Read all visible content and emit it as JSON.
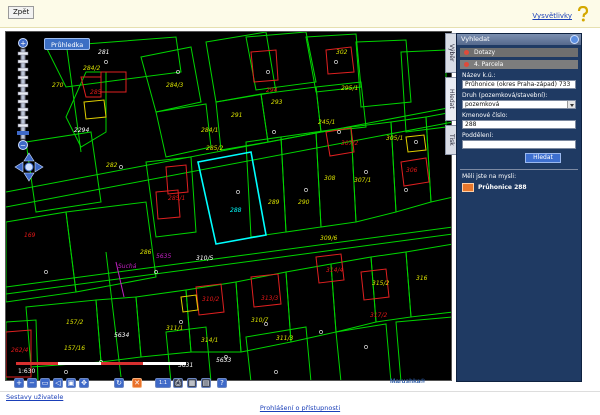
{
  "topbar": {
    "back_label": "Zpět",
    "help_label": "Vysvětlivky",
    "help_icon": "question-mark-icon"
  },
  "map": {
    "layer_button": "Průhledka",
    "scale_ratio": "1:630",
    "colors": {
      "background": "#000000",
      "parcel_lines": "#00e000",
      "selected_parcel": "#00ffff",
      "label_green": "#d8e000",
      "label_red": "#e01818",
      "label_magenta": "#c020c0"
    },
    "selected_parcel_number": "288",
    "parcel_labels": [
      {
        "text": "281",
        "style": "white"
      },
      {
        "text": "284/2",
        "style": "green"
      },
      {
        "text": "285",
        "style": "red"
      },
      {
        "text": "284/3",
        "style": "green"
      },
      {
        "text": "284/1",
        "style": "green"
      },
      {
        "text": "291",
        "style": "green"
      },
      {
        "text": "294",
        "style": "red"
      },
      {
        "text": "293",
        "style": "green"
      },
      {
        "text": "295/1",
        "style": "green"
      },
      {
        "text": "302",
        "style": "green"
      },
      {
        "text": "285/2",
        "style": "green"
      },
      {
        "text": "245/1",
        "style": "green"
      },
      {
        "text": "307/2",
        "style": "red"
      },
      {
        "text": "305/1",
        "style": "green"
      },
      {
        "text": "282",
        "style": "green"
      },
      {
        "text": "285/1",
        "style": "red"
      },
      {
        "text": "289",
        "style": "green"
      },
      {
        "text": "290",
        "style": "green"
      },
      {
        "text": "308",
        "style": "green"
      },
      {
        "text": "307/1",
        "style": "green"
      },
      {
        "text": "306",
        "style": "red"
      },
      {
        "text": "2294",
        "style": "white"
      },
      {
        "text": "270",
        "style": "green"
      },
      {
        "text": "169",
        "style": "red"
      },
      {
        "text": "286",
        "style": "green"
      },
      {
        "text": "309/6",
        "style": "green"
      },
      {
        "text": "310/5",
        "style": "white"
      },
      {
        "text": "310/2",
        "style": "red"
      },
      {
        "text": "313/3",
        "style": "red"
      },
      {
        "text": "314/4",
        "style": "red"
      },
      {
        "text": "315/2",
        "style": "green"
      },
      {
        "text": "316",
        "style": "green"
      },
      {
        "text": "317/2",
        "style": "red"
      },
      {
        "text": "310/7",
        "style": "green"
      },
      {
        "text": "311/1",
        "style": "green"
      },
      {
        "text": "314/1",
        "style": "green"
      },
      {
        "text": "311/3",
        "style": "green"
      },
      {
        "text": "157/2",
        "style": "green"
      },
      {
        "text": "157/16",
        "style": "green"
      },
      {
        "text": "262/4",
        "style": "red"
      },
      {
        "text": "Suchá",
        "style": "magenta"
      },
      {
        "text": "5635",
        "style": "magenta"
      },
      {
        "text": "5634",
        "style": "white"
      },
      {
        "text": "5631",
        "style": "white"
      },
      {
        "text": "5633",
        "style": "white"
      }
    ]
  },
  "side_tabs": [
    "Výběr",
    "Hledat",
    "Tisk"
  ],
  "panel": {
    "title": "Vyhledat",
    "section_queries": "Dotazy",
    "section_parcel": "4. Parcela",
    "cadastre_label": "Název k.ú.:",
    "cadastre_value": "Průhonice (okres Praha-západ) 733",
    "kind_label": "Druh (pozemková/stavební):",
    "kind_value": "pozemková",
    "parcel_number_label": "Kmenové číslo:",
    "parcel_number_value": "288",
    "subdivision_label": "Poddělení:",
    "subdivision_value": "",
    "search_button": "Hledat",
    "result_label": "Měli jste na mysli:",
    "result_value": "Průhonice 288"
  },
  "toolbar": {
    "buttons": [
      {
        "name": "zoom-in-button",
        "glyph": "+"
      },
      {
        "name": "zoom-out-button",
        "glyph": "−"
      },
      {
        "name": "zoom-box-button",
        "glyph": "▭"
      },
      {
        "name": "zoom-previous-button",
        "glyph": "◁"
      },
      {
        "name": "zoom-extent-button",
        "glyph": "▣"
      },
      {
        "name": "pan-button",
        "glyph": "✥"
      },
      {
        "name": "refresh-button",
        "glyph": "↻"
      },
      {
        "name": "clear-button",
        "glyph": "✕"
      },
      {
        "name": "measure-button",
        "glyph": "1:1"
      },
      {
        "name": "print-button",
        "glyph": "⎙"
      },
      {
        "name": "export-button",
        "glyph": "▦"
      },
      {
        "name": "save-button",
        "glyph": "▤"
      },
      {
        "name": "help-button",
        "glyph": "?"
      }
    ],
    "brand": "Marushka®"
  },
  "footer": {
    "saved_users_label": "Sestavy uživatele",
    "access_label": "Prohlášení o přístupnosti"
  }
}
